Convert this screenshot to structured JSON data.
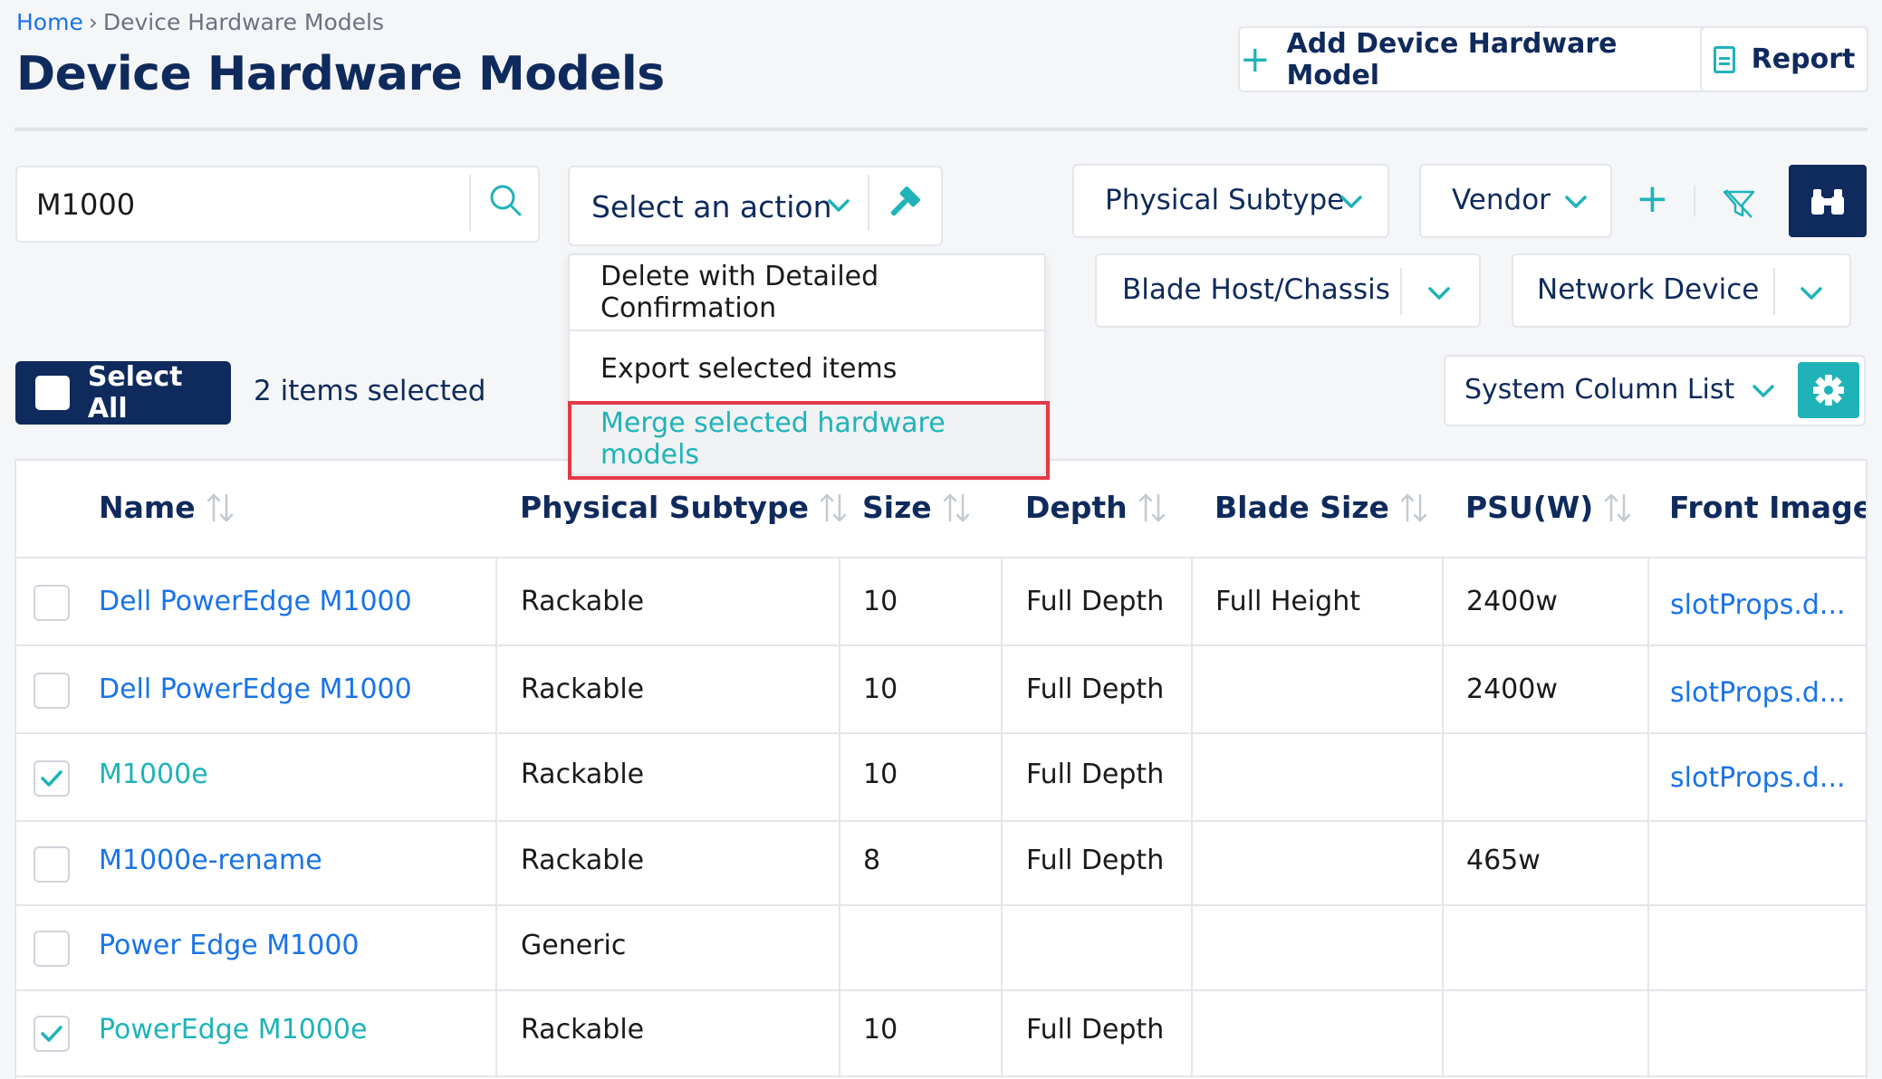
{
  "breadcrumb": {
    "home": "Home",
    "separator": "›",
    "current": "Device Hardware Models"
  },
  "page_title": "Device Hardware Models",
  "header_buttons": {
    "add": "Add Device Hardware Model",
    "report": "Report"
  },
  "search": {
    "value": "M1000"
  },
  "action_select": {
    "label": "Select an action"
  },
  "action_menu": {
    "items": [
      "Delete with Detailed Confirmation",
      "Export selected items",
      "Merge selected hardware models"
    ]
  },
  "filters": {
    "physical_subtype": "Physical Subtype",
    "vendor": "Vendor",
    "blade_host": "Blade Host/Chassis",
    "network_device": "Network Device"
  },
  "selection": {
    "select_all": "Select All",
    "count_text": "2 items selected"
  },
  "column_list": {
    "label": "System Column List"
  },
  "colors": {
    "navy": "#0f2a5c",
    "teal": "#1fb3b9",
    "link": "#1a73e8",
    "highlight": "#e53945"
  },
  "table": {
    "columns": [
      "Name",
      "Physical Subtype",
      "Size",
      "Depth",
      "Blade Size",
      "PSU(W)",
      "Front Image"
    ],
    "rows": [
      {
        "checked": false,
        "name": "Dell PowerEdge M1000",
        "subtype": "Rackable",
        "size": "10",
        "depth": "Full Depth",
        "blade_size": "Full Height",
        "psu": "2400w",
        "front_image": "slotProps.d..."
      },
      {
        "checked": false,
        "name": "Dell PowerEdge M1000",
        "subtype": "Rackable",
        "size": "10",
        "depth": "Full Depth",
        "blade_size": "",
        "psu": "2400w",
        "front_image": "slotProps.d..."
      },
      {
        "checked": true,
        "name": "M1000e",
        "subtype": "Rackable",
        "size": "10",
        "depth": "Full Depth",
        "blade_size": "",
        "psu": "",
        "front_image": "slotProps.d..."
      },
      {
        "checked": false,
        "name": "M1000e-rename",
        "subtype": "Rackable",
        "size": "8",
        "depth": "Full Depth",
        "blade_size": "",
        "psu": "465w",
        "front_image": ""
      },
      {
        "checked": false,
        "name": "Power Edge M1000",
        "subtype": "Generic",
        "size": "",
        "depth": "",
        "blade_size": "",
        "psu": "",
        "front_image": ""
      },
      {
        "checked": true,
        "name": "PowerEdge M1000e",
        "subtype": "Rackable",
        "size": "10",
        "depth": "Full Depth",
        "blade_size": "",
        "psu": "",
        "front_image": ""
      }
    ]
  }
}
